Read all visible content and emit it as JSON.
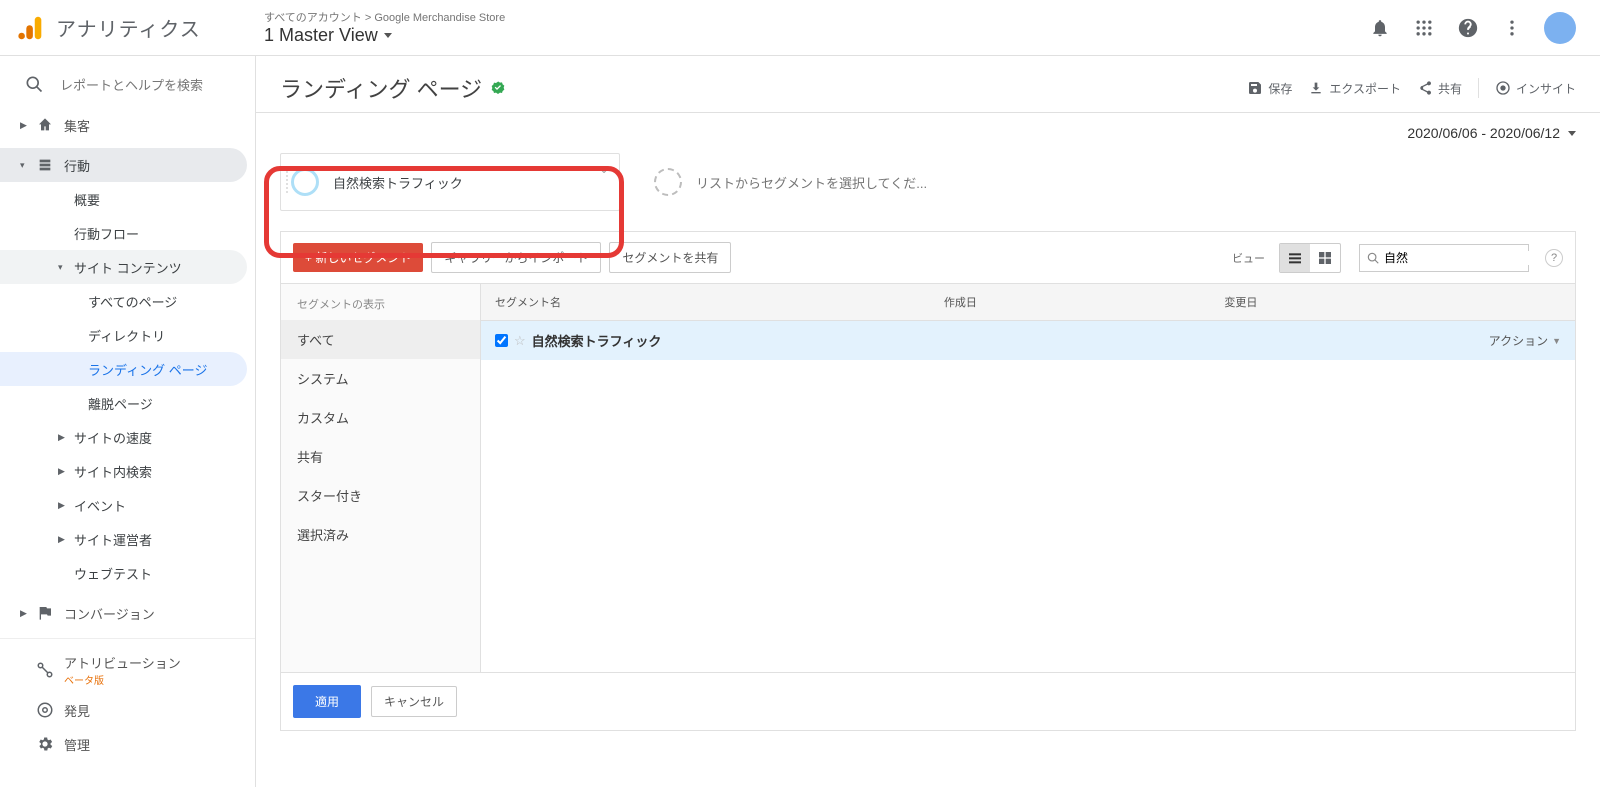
{
  "header": {
    "product_name": "アナリティクス",
    "breadcrumb_prefix": "すべてのアカウント >",
    "breadcrumb_account": "Google Merchandise Store",
    "view_name": "1 Master View"
  },
  "sidebar": {
    "search_placeholder": "レポートとヘルプを検索",
    "items": {
      "acquisition": "集客",
      "behavior": "行動",
      "overview": "概要",
      "behavior_flow": "行動フロー",
      "site_content": "サイト コンテンツ",
      "all_pages": "すべてのページ",
      "directory": "ディレクトリ",
      "landing": "ランディング ページ",
      "exit": "離脱ページ",
      "site_speed": "サイトの速度",
      "site_search": "サイト内検索",
      "events": "イベント",
      "publisher": "サイト運営者",
      "webtest": "ウェブテスト",
      "conversion": "コンバージョン",
      "attribution": "アトリビューション",
      "attribution_beta": "ベータ版",
      "discover": "発見",
      "admin": "管理"
    }
  },
  "content_header": {
    "title": "ランディング ページ",
    "actions": {
      "save": "保存",
      "export": "エクスポート",
      "share": "共有",
      "insights": "インサイト"
    },
    "date_range": "2020/06/06 - 2020/06/12"
  },
  "segments": {
    "active_label": "自然検索トラフィック",
    "add_label": "リストからセグメントを選択してくだ..."
  },
  "modal": {
    "buttons": {
      "new": "+ 新しいセグメント",
      "import": "ギャラリーからインポート",
      "share": "セグメントを共有",
      "view_label": "ビュー",
      "apply": "適用",
      "cancel": "キャンセル"
    },
    "search_value": "自然",
    "side_title": "セグメントの表示",
    "side_items": [
      "すべて",
      "システム",
      "カスタム",
      "共有",
      "スター付き",
      "選択済み"
    ],
    "active_side_index": 0,
    "columns": {
      "name": "セグメント名",
      "created": "作成日",
      "modified": "変更日"
    },
    "rows": [
      {
        "name": "自然検索トラフィック",
        "checked": true
      }
    ],
    "action_label": "アクション"
  }
}
